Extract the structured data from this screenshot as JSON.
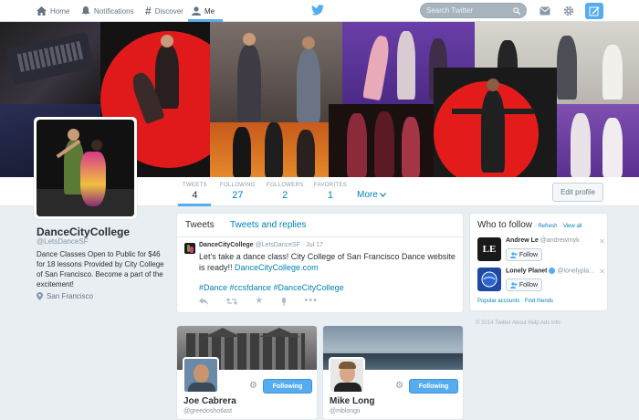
{
  "nav": {
    "home": "Home",
    "notifications": "Notifications",
    "discover": "Discover",
    "me": "Me",
    "search_placeholder": "Search Twitter"
  },
  "profile": {
    "name": "DanceCityCollege",
    "handle": "@LetsDanceSF",
    "bio": "Dance Classes Open to Public for $46 for 18 lessons Provided by City College of San Francisco. Become a part of the excitement!",
    "location": "San Francisco",
    "edit_label": "Edit profile"
  },
  "stats": [
    {
      "label": "TWEETS",
      "value": "4"
    },
    {
      "label": "FOLLOWING",
      "value": "27"
    },
    {
      "label": "FOLLOWERS",
      "value": "2"
    },
    {
      "label": "FAVORITES",
      "value": "1"
    }
  ],
  "more_label": "More",
  "tabs": {
    "tweets": "Tweets",
    "replies": "Tweets and replies"
  },
  "tweet": {
    "name": "DanceCityCollege",
    "handle": "@LetsDanceSF",
    "sep": "·",
    "date": "Jul 17",
    "text": "Let's take a dance class! City College of San Francisco Dance website is ready!!",
    "link": "DanceCityCollege.com",
    "hashtags": "#Dance #ccsfdance #DanceCityCollege"
  },
  "who_to_follow": {
    "title": "Who to follow",
    "refresh": "· Refresh",
    "view_all": "· View all",
    "items": [
      {
        "name": "Andrew Le",
        "handle": "@andrewmyk",
        "follow": "Follow",
        "logo_text": "LE"
      },
      {
        "name": "Lonely Planet",
        "handle": "@lonelypla...",
        "follow": "Follow"
      }
    ],
    "popular": "Popular accounts",
    "find_friends": "· Find friends"
  },
  "footer": "© 2014 Twitter   About   Help   Ads info",
  "cards": [
    {
      "name": "Joe Cabrera",
      "handle": "@greedoshotlast",
      "button": "Following"
    },
    {
      "name": "Mike Long",
      "handle": "@mblongii",
      "button": "Following"
    }
  ],
  "colors": {
    "accent": "#55acee",
    "link": "#0084b4",
    "background": "#e9eef2"
  }
}
